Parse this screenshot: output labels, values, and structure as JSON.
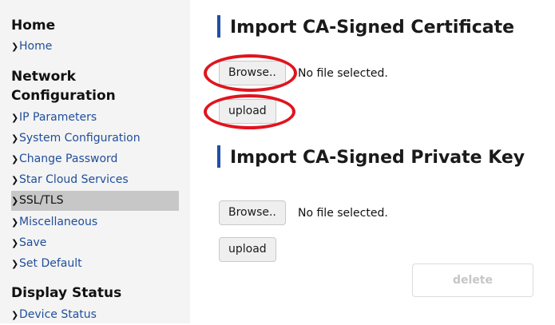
{
  "sidebar": {
    "sections": [
      {
        "title": "Home",
        "items": [
          {
            "label": "Home"
          }
        ]
      },
      {
        "title": "Network Configuration",
        "items": [
          {
            "label": "IP Parameters"
          },
          {
            "label": "System Configuration"
          },
          {
            "label": "Change Password"
          },
          {
            "label": "Star Cloud Services"
          },
          {
            "label": "SSL/TLS"
          },
          {
            "label": "Miscellaneous"
          },
          {
            "label": "Save"
          },
          {
            "label": "Set Default"
          }
        ]
      },
      {
        "title": "Display Status",
        "items": [
          {
            "label": "Device Status"
          }
        ]
      }
    ],
    "network_title_line1": "Network",
    "network_title_line2": "Configuration",
    "active_item": "SSL/TLS",
    "chevron_icon": "chevron-right-icon"
  },
  "main": {
    "certificate": {
      "title": "Import CA-Signed Certificate",
      "browse_label": "Browse..",
      "file_status": "No file selected.",
      "upload_label": "upload"
    },
    "private_key": {
      "title": "Import CA-Signed Private Key",
      "browse_label": "Browse..",
      "file_status": "No file selected.",
      "upload_label": "upload"
    },
    "delete_label": "delete"
  },
  "colors": {
    "accent_bar": "#1e4fa8",
    "link": "#1f4e9a",
    "highlight_circle": "#e0141e",
    "active_item_bg": "#c7c7c7"
  }
}
